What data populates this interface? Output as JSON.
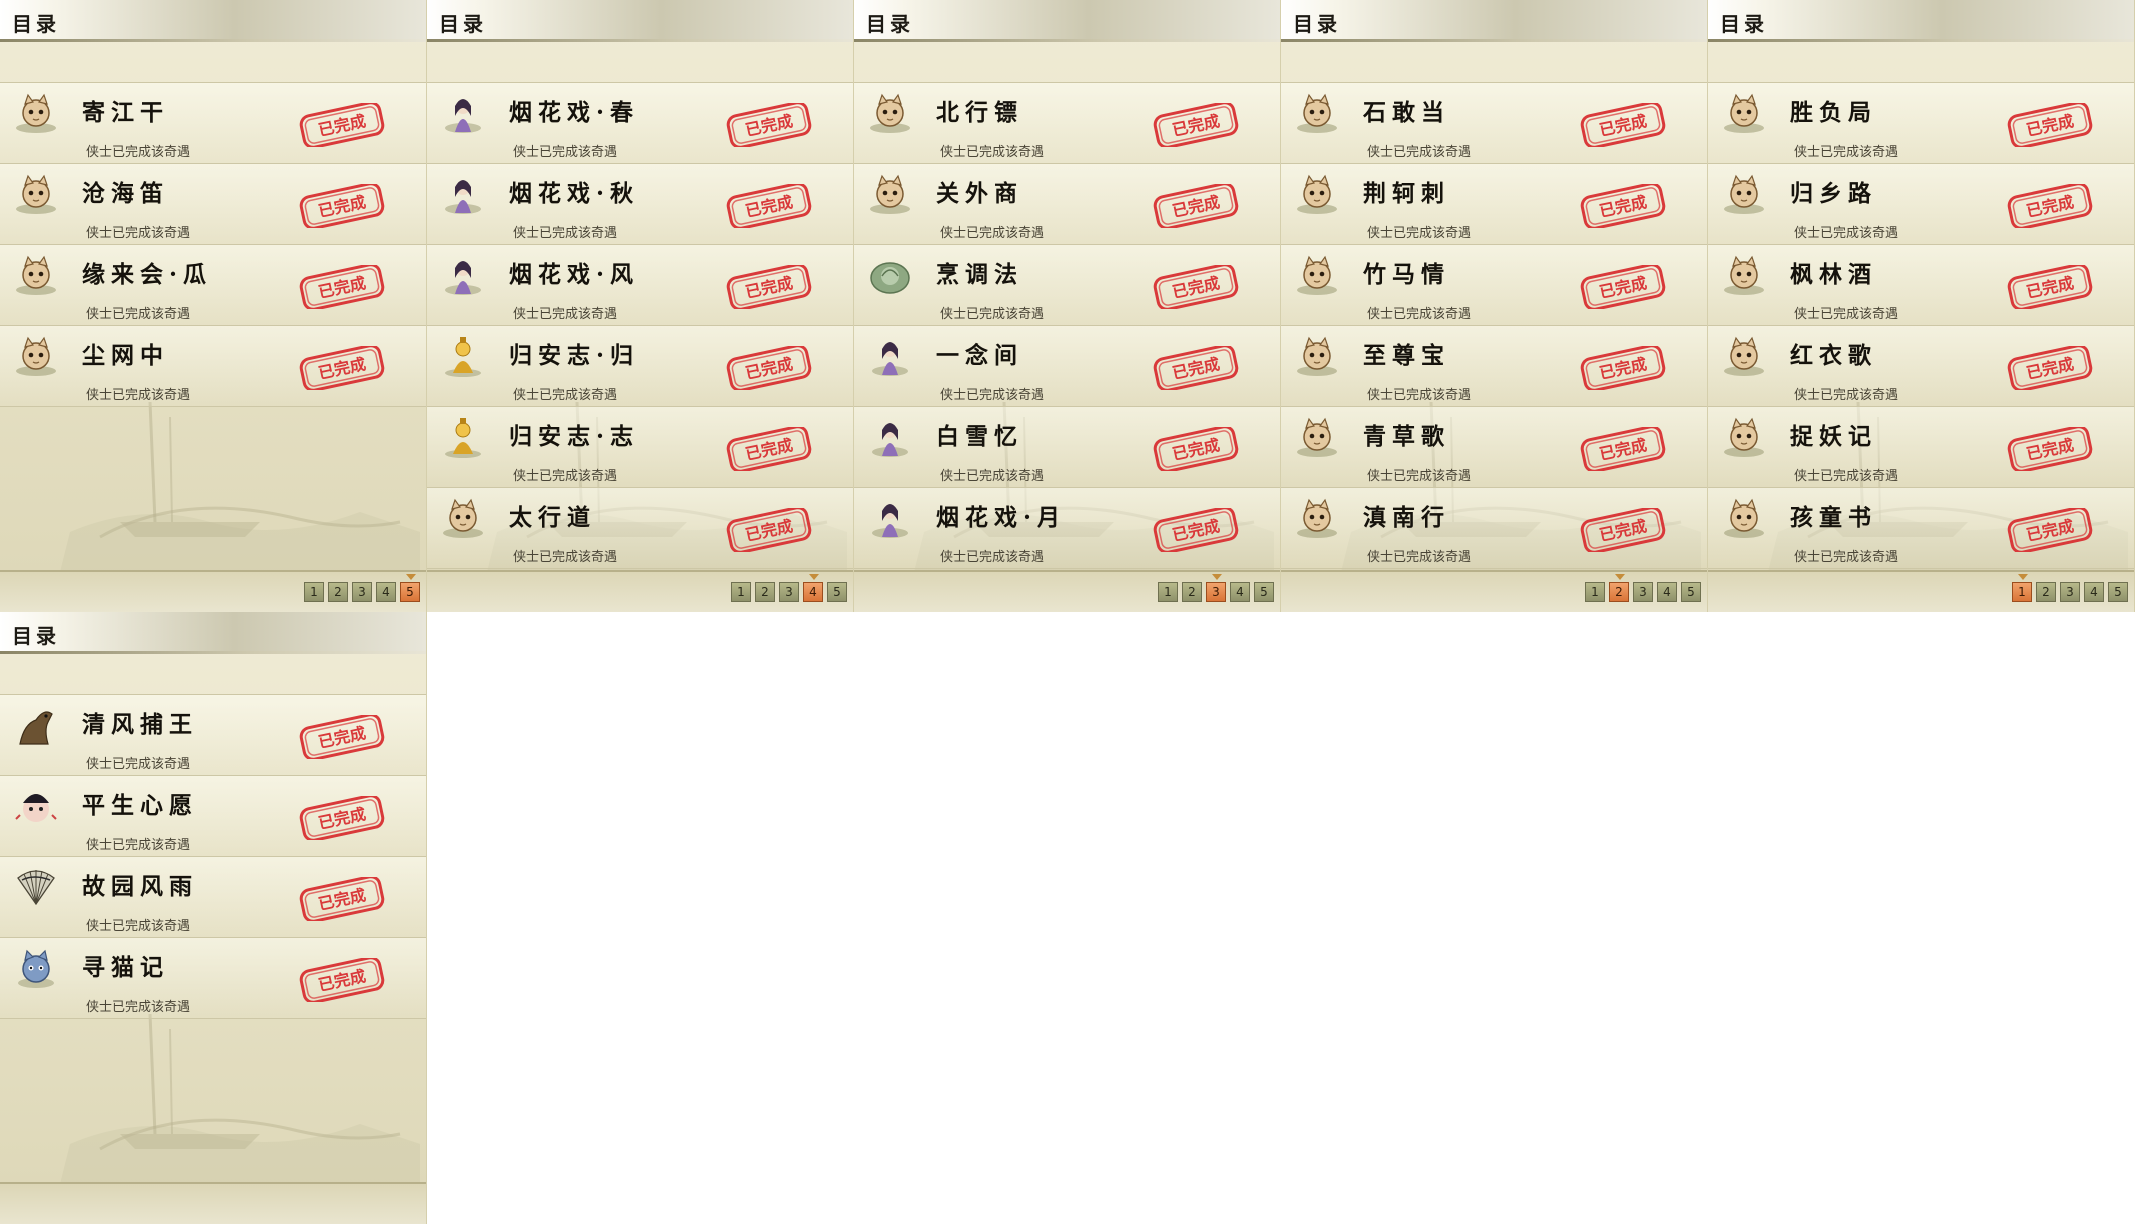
{
  "panel_title": "目录",
  "completed_label": "侠士已完成该奇遇",
  "stamp_text": "已完成",
  "pages": [
    "1",
    "2",
    "3",
    "4",
    "5"
  ],
  "panels": [
    {
      "active_page": "5",
      "items": [
        {
          "name": "寄江干",
          "icon": "cat-icon"
        },
        {
          "name": "沧海笛",
          "icon": "cat-icon"
        },
        {
          "name": "缘来会·瓜",
          "icon": "cat-icon"
        },
        {
          "name": "尘网中",
          "icon": "cat-icon"
        }
      ]
    },
    {
      "active_page": "4",
      "items": [
        {
          "name": "烟花戏·春",
          "icon": "lady-icon"
        },
        {
          "name": "烟花戏·秋",
          "icon": "lady-icon"
        },
        {
          "name": "烟花戏·风",
          "icon": "lady-icon"
        },
        {
          "name": "归安志·归",
          "icon": "golden-figure-icon"
        },
        {
          "name": "归安志·志",
          "icon": "golden-figure-icon"
        },
        {
          "name": "太行道",
          "icon": "cat-icon"
        }
      ]
    },
    {
      "active_page": "3",
      "items": [
        {
          "name": "北行镖",
          "icon": "cat-icon"
        },
        {
          "name": "关外商",
          "icon": "cat-icon"
        },
        {
          "name": "烹调法",
          "icon": "green-plate-icon"
        },
        {
          "name": "一念间",
          "icon": "lady-icon"
        },
        {
          "name": "白雪忆",
          "icon": "lady-icon"
        },
        {
          "name": "烟花戏·月",
          "icon": "lady-icon"
        }
      ]
    },
    {
      "active_page": "2",
      "items": [
        {
          "name": "石敢当",
          "icon": "cat-icon"
        },
        {
          "name": "荆轲刺",
          "icon": "cat-icon"
        },
        {
          "name": "竹马情",
          "icon": "cat-icon"
        },
        {
          "name": "至尊宝",
          "icon": "cat-icon"
        },
        {
          "name": "青草歌",
          "icon": "cat-icon"
        },
        {
          "name": "滇南行",
          "icon": "cat-icon"
        }
      ]
    },
    {
      "active_page": "1",
      "items": [
        {
          "name": "胜负局",
          "icon": "cat-icon"
        },
        {
          "name": "归乡路",
          "icon": "cat-icon"
        },
        {
          "name": "枫林酒",
          "icon": "cat-icon"
        },
        {
          "name": "红衣歌",
          "icon": "cat-icon"
        },
        {
          "name": "捉妖记",
          "icon": "cat-icon"
        },
        {
          "name": "孩童书",
          "icon": "cat-icon"
        }
      ]
    },
    {
      "active_page": null,
      "items": [
        {
          "name": "清风捕王",
          "icon": "horse-icon"
        },
        {
          "name": "平生心愿",
          "icon": "round-face-icon"
        },
        {
          "name": "故园风雨",
          "icon": "fan-icon"
        },
        {
          "name": "寻猫记",
          "icon": "blue-cat-icon"
        }
      ]
    }
  ]
}
